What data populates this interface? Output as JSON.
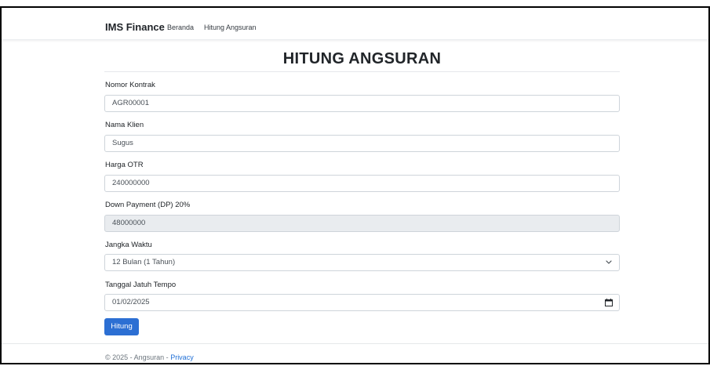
{
  "navbar": {
    "brand": "IMS Finance",
    "links": [
      "Beranda",
      "Hitung Angsuran"
    ]
  },
  "page": {
    "title": "HITUNG ANGSURAN"
  },
  "form": {
    "contract_number": {
      "label": "Nomor Kontrak",
      "value": "AGR00001"
    },
    "client_name": {
      "label": "Nama Klien",
      "value": "Sugus"
    },
    "otr_price": {
      "label": "Harga OTR",
      "value": "240000000"
    },
    "down_payment": {
      "label": "Down Payment (DP) 20%",
      "value": "48000000"
    },
    "term": {
      "label": "Jangka Waktu",
      "value": "12 Bulan (1 Tahun)"
    },
    "due_date": {
      "label": "Tanggal Jatuh Tempo",
      "value": "01/02/2025"
    },
    "submit_label": "Hitung"
  },
  "footer": {
    "copyright": "© 2025 - Angsuran - ",
    "privacy_link": "Privacy"
  },
  "colors": {
    "primary_button": "#2c6fd3",
    "link": "#1f6fd6",
    "readonly_bg": "#e9ecef",
    "border": "#ced4da"
  },
  "icons": {
    "select": "chevron-down-icon",
    "date": "calendar-icon"
  }
}
